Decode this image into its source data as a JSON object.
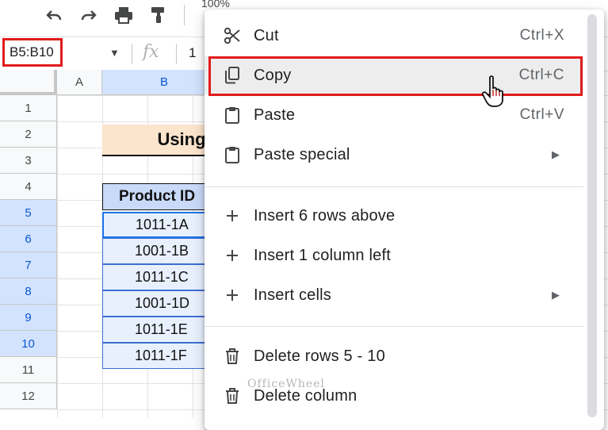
{
  "toolbar": {
    "icons": [
      "undo-icon",
      "redo-icon",
      "print-icon",
      "paint-format-icon"
    ],
    "zoom_partial": "100%"
  },
  "formula_bar": {
    "name_box": "B5:B10",
    "fx": "fx",
    "value_partial": "1"
  },
  "grid": {
    "columns": [
      "A",
      "B"
    ],
    "rows": [
      "1",
      "2",
      "3",
      "4",
      "5",
      "6",
      "7",
      "8",
      "9",
      "10",
      "11",
      "12"
    ],
    "title_partial": "Using",
    "table_header": "Product ID",
    "cells": [
      "1011-1A",
      "1001-1B",
      "1011-1C",
      "1001-1D",
      "1011-1E",
      "1011-1F"
    ]
  },
  "context_menu": {
    "items": [
      {
        "label": "Cut",
        "shortcut": "Ctrl+X",
        "icon": "scissors-icon"
      },
      {
        "label": "Copy",
        "shortcut": "Ctrl+C",
        "icon": "copy-icon"
      },
      {
        "label": "Paste",
        "shortcut": "Ctrl+V",
        "icon": "clipboard-icon"
      },
      {
        "label": "Paste special",
        "shortcut": "",
        "icon": "clipboard-icon"
      },
      {
        "label": "Insert 6 rows above",
        "shortcut": "",
        "icon": "plus-icon"
      },
      {
        "label": "Insert 1 column left",
        "shortcut": "",
        "icon": "plus-icon"
      },
      {
        "label": "Insert cells",
        "shortcut": "",
        "icon": "plus-icon"
      },
      {
        "label": "Delete rows 5 - 10",
        "shortcut": "",
        "icon": "trash-icon"
      },
      {
        "label": "Delete column",
        "shortcut": "",
        "icon": "trash-icon"
      }
    ],
    "hovered": "Copy"
  },
  "watermark": "OfficeWheel"
}
